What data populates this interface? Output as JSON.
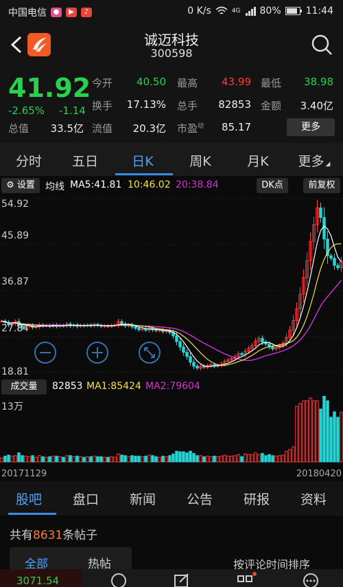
{
  "status": {
    "carrier": "中国电信",
    "speed": "0 K/s",
    "network": "4G",
    "battery": "80%",
    "time": "11:44",
    "icons": [
      "pig-icon",
      "video-icon",
      "music-icon",
      "eye-icon",
      "wifi-icon",
      "signal-icon",
      "battery-icon"
    ]
  },
  "header": {
    "title": "诚迈科技",
    "code": "300598"
  },
  "quote": {
    "price": "41.92",
    "change_pct": "-2.65%",
    "change": "-1.14",
    "open_label": "今开",
    "open": "40.50",
    "high_label": "最高",
    "high": "43.99",
    "low_label": "最低",
    "low": "38.98",
    "turnover_label": "换手",
    "turnover": "17.13%",
    "volume_label": "总手",
    "volume": "82853",
    "amount_label": "金额",
    "amount": "3.40亿",
    "mktcap_label": "总值",
    "mktcap": "33.5亿",
    "float_label": "流值",
    "float": "20.3亿",
    "pe_label": "市盈",
    "pe_sup": "动",
    "pe": "85.17",
    "more": "更多"
  },
  "periods": [
    "分时",
    "五日",
    "日K",
    "周K",
    "月K",
    "更多"
  ],
  "active_period": 2,
  "kbar": {
    "settings": "设置",
    "ma_label": "均线",
    "ma5": "MA5:41.81",
    "ma10": "10:46.02",
    "ma20": "20:38.84",
    "dk": "DK点",
    "adjust": "前复权"
  },
  "colors": {
    "up": "#ff3b3b",
    "down": "#27d3d3",
    "ma5": "#ffffff",
    "ma10": "#f5e04a",
    "ma20": "#d632d6",
    "green": "#2bd04d",
    "accent": "#3a8ee6"
  },
  "chart_data": {
    "type": "candlestick",
    "y_ticks": [
      "54.92",
      "45.89",
      "36.87",
      "27.84",
      "18.81"
    ],
    "ylim": [
      18.81,
      54.92
    ],
    "x_start": "20171129",
    "x_end": "20180420",
    "volume_label": "成交量",
    "volume_value": "82853",
    "volume_ma1": "MA1:85424",
    "volume_ma2": "MA2:79604",
    "volume_tick": "13万",
    "close": [
      29.4,
      29.1,
      28.6,
      28.9,
      29.3,
      28.4,
      28.0,
      28.3,
      28.5,
      28.1,
      28.2,
      28.6,
      28.4,
      28.5,
      28.3,
      28.6,
      28.3,
      28.5,
      28.4,
      28.8,
      28.4,
      28.6,
      28.3,
      28.5,
      28.4,
      28.6,
      28.4,
      28.7,
      28.5,
      28.3,
      28.4,
      28.3,
      28.5,
      28.6,
      29.3,
      28.8,
      28.4,
      28.6,
      28.2,
      27.9,
      27.6,
      27.8,
      27.5,
      28.0,
      27.6,
      27.4,
      27.5,
      27.2,
      27.4,
      27.0,
      26.3,
      25.1,
      24.0,
      22.9,
      22.0,
      20.8,
      20.0,
      19.6,
      20.0,
      19.8,
      20.1,
      20.3,
      20.0,
      20.2,
      20.5,
      21.0,
      21.3,
      21.6,
      22.0,
      22.6,
      22.4,
      23.1,
      23.7,
      24.3,
      25.2,
      25.8,
      25.0,
      24.6,
      24.0,
      23.6,
      23.9,
      24.3,
      24.8,
      26.0,
      27.5,
      29.5,
      32.0,
      35.0,
      38.5,
      42.0,
      46.0,
      49.5,
      53.0,
      51.0,
      46.5,
      43.0,
      42.5,
      41.0,
      40.5,
      41.92
    ]
  },
  "bottom_tabs": [
    "股吧",
    "盘口",
    "新闻",
    "公告",
    "研报",
    "资料"
  ],
  "posts": {
    "prefix": "共有",
    "count": "8631",
    "suffix": "条帖子"
  },
  "subtabs": {
    "all": "全部",
    "hot": "热帖",
    "sort": "按评论时间排序"
  },
  "bottom_bar": {
    "index": "3071.54"
  }
}
